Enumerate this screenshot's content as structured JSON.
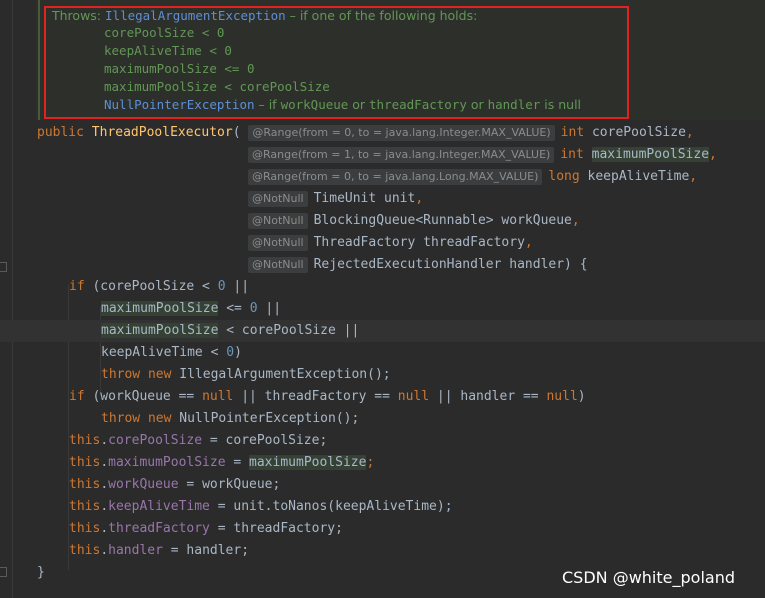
{
  "javadoc": {
    "throws_label": "Throws:",
    "exc1": "IllegalArgumentException",
    "exc1_desc": " – if one of the following holds:",
    "cond1": "corePoolSize < 0",
    "cond2": "keepAliveTime < 0",
    "cond3": "maximumPoolSize <= 0",
    "cond4": "maximumPoolSize < corePoolSize",
    "exc2": "NullPointerException",
    "exc2_desc_a": " – if ",
    "exc2_p1": "workQueue",
    "exc2_or1": " or ",
    "exc2_p2": "threadFactory",
    "exc2_or2": " or ",
    "exc2_p3": "handler",
    "exc2_end": " is null"
  },
  "signature": {
    "public": "public",
    "name": "ThreadPoolExecutor",
    "open": "(",
    "anno1": "@Range(from = 0, to = java.lang.Integer.MAX_VALUE)",
    "anno2": "@Range(from = 1, to = java.lang.Integer.MAX_VALUE)",
    "anno3": "@Range(from = 0, to = java.lang.Long.MAX_VALUE)",
    "notnull": "@NotNull",
    "int": "int",
    "long": "long",
    "p1": "corePoolSize",
    "p2": "maximumPoolSize",
    "p3": "keepAliveTime",
    "p4": "TimeUnit unit",
    "p5": "BlockingQueue<Runnable> workQueue",
    "p6": "ThreadFactory threadFactory",
    "p7": "RejectedExecutionHandler handler) {",
    "comma": ","
  },
  "body": {
    "if": "if",
    "throw": "throw",
    "new": "new",
    "null": "null",
    "this": "this",
    "zero": "0",
    "l1a": " (corePoolSize < ",
    "l1b": " ||",
    "l2a": "maximumPoolSize",
    "l2b": " <= ",
    "l2c": " ||",
    "l3a": "maximumPoolSize",
    "l3b": " < corePoolSize ||",
    "l4a": "keepAliveTime < ",
    "l4b": ")",
    "l5": " IllegalArgumentException();",
    "l6a": " (workQueue == ",
    "l6b": " || threadFactory == ",
    "l6c": " || handler == ",
    "l6d": ")",
    "l7": " NullPointerException();",
    "a1f": "corePoolSize",
    "a1v": " = corePoolSize;",
    "a2f": "maximumPoolSize",
    "a2eq": " = ",
    "a2v": "maximumPoolSize",
    "a2end": ";",
    "a3f": "workQueue",
    "a3v": " = workQueue;",
    "a4f": "keepAliveTime",
    "a4v": " = unit.toNanos(keepAliveTime);",
    "a5f": "threadFactory",
    "a5v": " = threadFactory;",
    "a6f": "handler",
    "a6v": " = handler;",
    "close": "}",
    "dot": "."
  },
  "watermark": "CSDN @white_poland"
}
